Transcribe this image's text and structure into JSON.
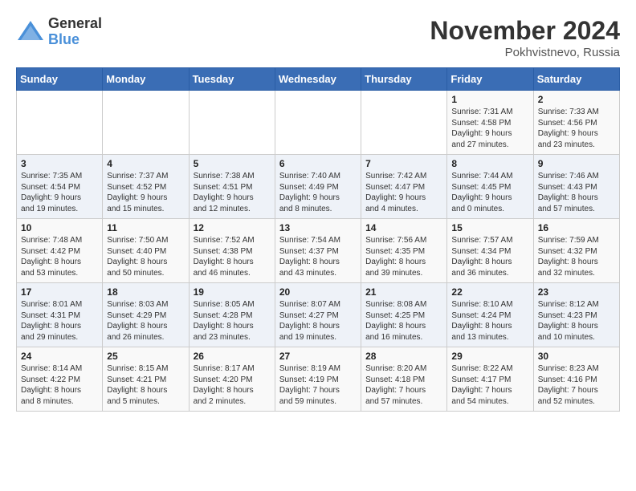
{
  "logo": {
    "general": "General",
    "blue": "Blue"
  },
  "title": "November 2024",
  "location": "Pokhvistnevo, Russia",
  "weekdays": [
    "Sunday",
    "Monday",
    "Tuesday",
    "Wednesday",
    "Thursday",
    "Friday",
    "Saturday"
  ],
  "weeks": [
    [
      {
        "day": null,
        "info": null
      },
      {
        "day": null,
        "info": null
      },
      {
        "day": null,
        "info": null
      },
      {
        "day": null,
        "info": null
      },
      {
        "day": null,
        "info": null
      },
      {
        "day": "1",
        "info": "Sunrise: 7:31 AM\nSunset: 4:58 PM\nDaylight: 9 hours\nand 27 minutes."
      },
      {
        "day": "2",
        "info": "Sunrise: 7:33 AM\nSunset: 4:56 PM\nDaylight: 9 hours\nand 23 minutes."
      }
    ],
    [
      {
        "day": "3",
        "info": "Sunrise: 7:35 AM\nSunset: 4:54 PM\nDaylight: 9 hours\nand 19 minutes."
      },
      {
        "day": "4",
        "info": "Sunrise: 7:37 AM\nSunset: 4:52 PM\nDaylight: 9 hours\nand 15 minutes."
      },
      {
        "day": "5",
        "info": "Sunrise: 7:38 AM\nSunset: 4:51 PM\nDaylight: 9 hours\nand 12 minutes."
      },
      {
        "day": "6",
        "info": "Sunrise: 7:40 AM\nSunset: 4:49 PM\nDaylight: 9 hours\nand 8 minutes."
      },
      {
        "day": "7",
        "info": "Sunrise: 7:42 AM\nSunset: 4:47 PM\nDaylight: 9 hours\nand 4 minutes."
      },
      {
        "day": "8",
        "info": "Sunrise: 7:44 AM\nSunset: 4:45 PM\nDaylight: 9 hours\nand 0 minutes."
      },
      {
        "day": "9",
        "info": "Sunrise: 7:46 AM\nSunset: 4:43 PM\nDaylight: 8 hours\nand 57 minutes."
      }
    ],
    [
      {
        "day": "10",
        "info": "Sunrise: 7:48 AM\nSunset: 4:42 PM\nDaylight: 8 hours\nand 53 minutes."
      },
      {
        "day": "11",
        "info": "Sunrise: 7:50 AM\nSunset: 4:40 PM\nDaylight: 8 hours\nand 50 minutes."
      },
      {
        "day": "12",
        "info": "Sunrise: 7:52 AM\nSunset: 4:38 PM\nDaylight: 8 hours\nand 46 minutes."
      },
      {
        "day": "13",
        "info": "Sunrise: 7:54 AM\nSunset: 4:37 PM\nDaylight: 8 hours\nand 43 minutes."
      },
      {
        "day": "14",
        "info": "Sunrise: 7:56 AM\nSunset: 4:35 PM\nDaylight: 8 hours\nand 39 minutes."
      },
      {
        "day": "15",
        "info": "Sunrise: 7:57 AM\nSunset: 4:34 PM\nDaylight: 8 hours\nand 36 minutes."
      },
      {
        "day": "16",
        "info": "Sunrise: 7:59 AM\nSunset: 4:32 PM\nDaylight: 8 hours\nand 32 minutes."
      }
    ],
    [
      {
        "day": "17",
        "info": "Sunrise: 8:01 AM\nSunset: 4:31 PM\nDaylight: 8 hours\nand 29 minutes."
      },
      {
        "day": "18",
        "info": "Sunrise: 8:03 AM\nSunset: 4:29 PM\nDaylight: 8 hours\nand 26 minutes."
      },
      {
        "day": "19",
        "info": "Sunrise: 8:05 AM\nSunset: 4:28 PM\nDaylight: 8 hours\nand 23 minutes."
      },
      {
        "day": "20",
        "info": "Sunrise: 8:07 AM\nSunset: 4:27 PM\nDaylight: 8 hours\nand 19 minutes."
      },
      {
        "day": "21",
        "info": "Sunrise: 8:08 AM\nSunset: 4:25 PM\nDaylight: 8 hours\nand 16 minutes."
      },
      {
        "day": "22",
        "info": "Sunrise: 8:10 AM\nSunset: 4:24 PM\nDaylight: 8 hours\nand 13 minutes."
      },
      {
        "day": "23",
        "info": "Sunrise: 8:12 AM\nSunset: 4:23 PM\nDaylight: 8 hours\nand 10 minutes."
      }
    ],
    [
      {
        "day": "24",
        "info": "Sunrise: 8:14 AM\nSunset: 4:22 PM\nDaylight: 8 hours\nand 8 minutes."
      },
      {
        "day": "25",
        "info": "Sunrise: 8:15 AM\nSunset: 4:21 PM\nDaylight: 8 hours\nand 5 minutes."
      },
      {
        "day": "26",
        "info": "Sunrise: 8:17 AM\nSunset: 4:20 PM\nDaylight: 8 hours\nand 2 minutes."
      },
      {
        "day": "27",
        "info": "Sunrise: 8:19 AM\nSunset: 4:19 PM\nDaylight: 7 hours\nand 59 minutes."
      },
      {
        "day": "28",
        "info": "Sunrise: 8:20 AM\nSunset: 4:18 PM\nDaylight: 7 hours\nand 57 minutes."
      },
      {
        "day": "29",
        "info": "Sunrise: 8:22 AM\nSunset: 4:17 PM\nDaylight: 7 hours\nand 54 minutes."
      },
      {
        "day": "30",
        "info": "Sunrise: 8:23 AM\nSunset: 4:16 PM\nDaylight: 7 hours\nand 52 minutes."
      }
    ]
  ]
}
